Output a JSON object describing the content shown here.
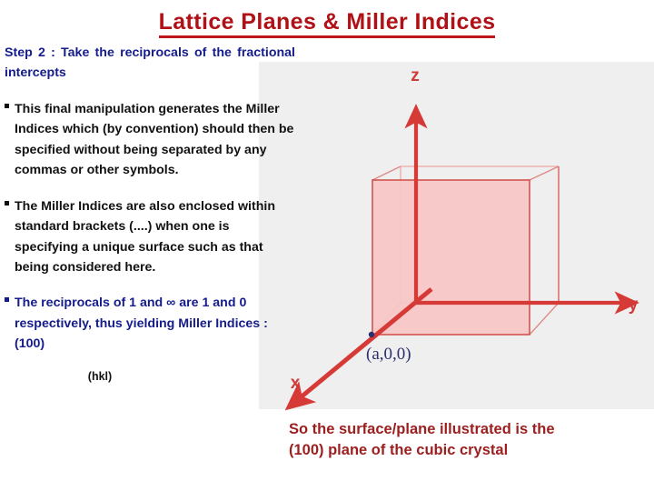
{
  "slide": {
    "title": "Lattice Planes & Miller Indices",
    "title_color": "#b01116",
    "background_color": "#ffffff",
    "panel_color": "#efefef"
  },
  "body_text": {
    "step": "Step 2 : Take the reciprocals of the fractional intercepts",
    "bullets": [
      {
        "marker": "§",
        "color": "#111111",
        "text": "This final manipulation generates the Miller Indices which (by convention) should then be specified without being separated by any commas or other symbols."
      },
      {
        "marker": "§",
        "color": "#111111",
        "text": "The Miller Indices are also enclosed within standard brackets (....) when one is specifying a unique surface such as that being considered here."
      },
      {
        "marker": "§",
        "color": "#141c8c",
        "text": "The reciprocals of 1 and ∞ are 1 and 0 respectively, thus yielding Miller Indices : (100)"
      }
    ],
    "hkl_note": "(hkl)"
  },
  "caption": {
    "line1": "So the surface/plane illustrated is the",
    "line2": "(100) plane of the cubic crystal",
    "color": "#9c1f1f"
  },
  "diagram": {
    "name": "cubic-unit-cell-with-100-plane",
    "axis_labels": {
      "z": "z",
      "y": "y",
      "x": "x"
    },
    "point_label": "(a,0,0)",
    "axis_color": "#d63a36",
    "cube_edge_color": "#e0716e",
    "plane_fill": "#f8c6c6",
    "plane_stroke": "#cf4a46",
    "point_color": "#2b2f6e"
  }
}
